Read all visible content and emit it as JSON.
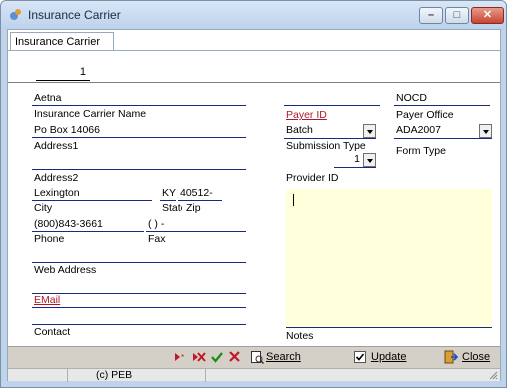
{
  "window": {
    "title": "Insurance Carrier",
    "accent": "#bfd3ea",
    "buttons": {
      "minimize_icon": "minimize-icon",
      "maximize_icon": "maximize-icon",
      "close_icon": "close-icon"
    }
  },
  "tabs": [
    {
      "label": "Insurance Carrier",
      "active": true
    }
  ],
  "record_number": "1",
  "form": {
    "carrier_name": {
      "value": "Aetna",
      "label": "Insurance Carrier Name"
    },
    "address1": {
      "value": "Po Box 14066",
      "label": "Address1"
    },
    "address2": {
      "value": "",
      "label": "Address2"
    },
    "city": {
      "value": "Lexington",
      "label": "City"
    },
    "state": {
      "value": "KY",
      "label": "State"
    },
    "zip": {
      "value": "40512-",
      "label": "Zip"
    },
    "phone": {
      "value": "(800)843-3661",
      "label": "Phone"
    },
    "fax": {
      "value": "(   )    -",
      "label": "Fax"
    },
    "web_address": {
      "value": "",
      "label": "Web Address"
    },
    "email": {
      "value": "",
      "label": "EMail"
    },
    "contact": {
      "value": "",
      "label": "Contact"
    },
    "payer_id": {
      "value": "",
      "label": "Payer ID"
    },
    "submission_type": {
      "value": "Batch",
      "label": "Submission Type"
    },
    "submission_number": {
      "value": "1"
    },
    "provider_id": {
      "label": "Provider ID"
    },
    "payer_office": {
      "value": "NOCD",
      "label": "Payer Office"
    },
    "form_type": {
      "value": "ADA2007",
      "label": "Form Type"
    },
    "notes": {
      "value": "",
      "label": "Notes"
    }
  },
  "toolbar": {
    "search_label": "Search",
    "update_label": "Update",
    "update_checked": true,
    "close_label": "Close",
    "colors": {
      "nav": "#c0182a",
      "save": "#1a8a1a",
      "cancel": "#c0182a"
    }
  },
  "status": {
    "copyright": "(c) PEB"
  }
}
